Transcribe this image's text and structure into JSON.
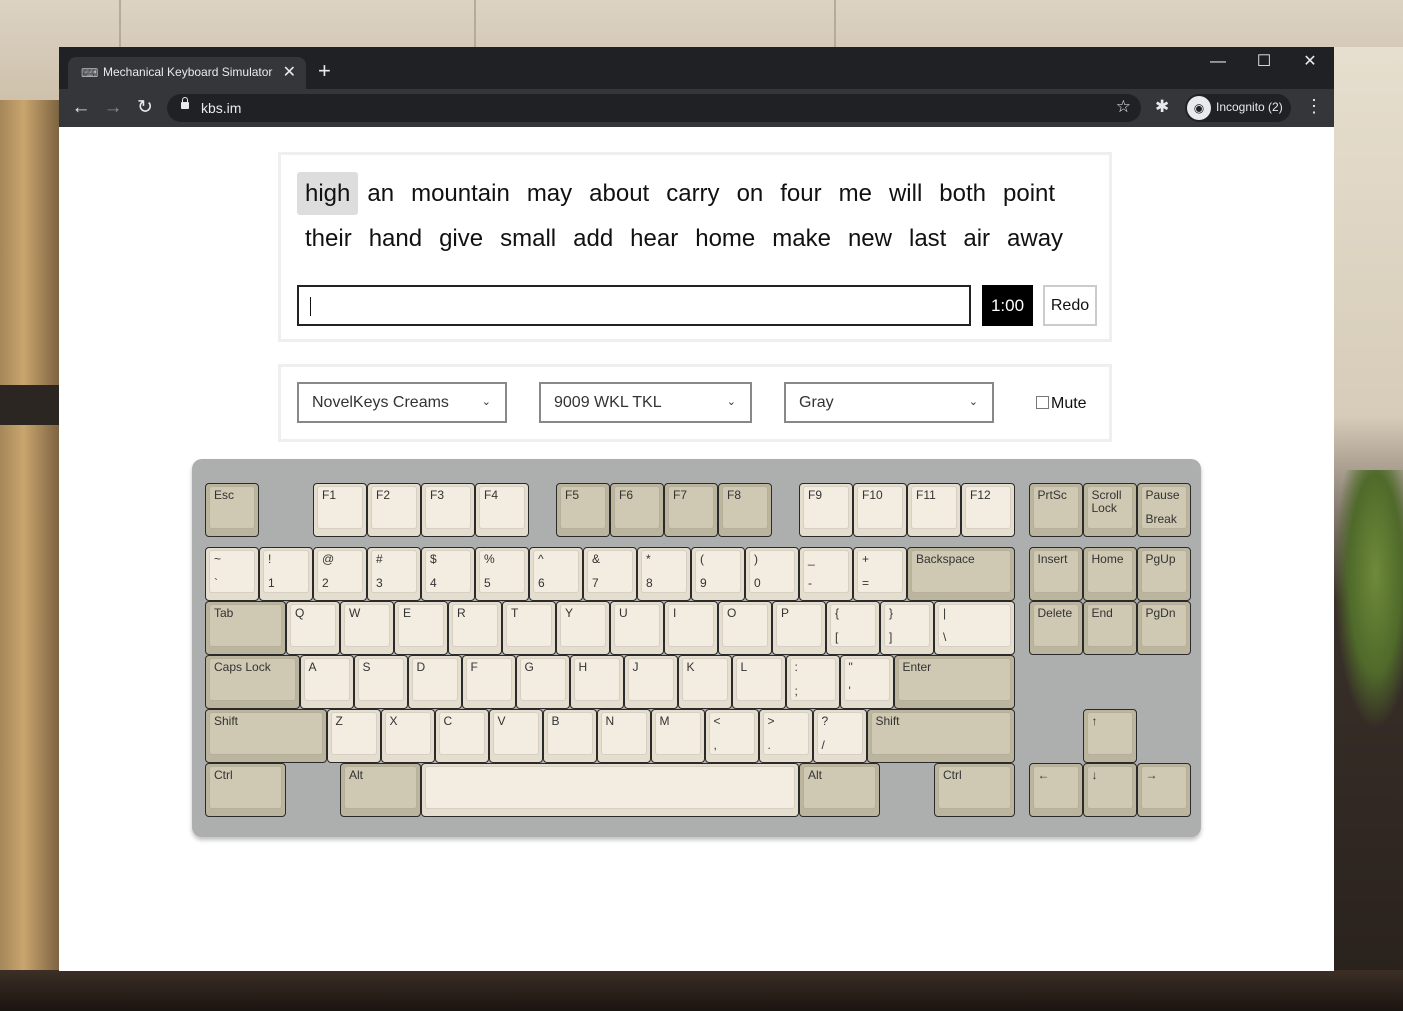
{
  "browser": {
    "tab_title": "Mechanical Keyboard Simulator",
    "tab_close": "✕",
    "new_tab": "+",
    "url": "kbs.im",
    "profile_label": "Incognito (2)",
    "back_icon": "←",
    "forward_icon": "→",
    "reload_icon": "↻",
    "star_icon": "☆",
    "extensions_icon": "✱",
    "menu_icon": "⋮",
    "minimize_icon": "—",
    "maximize_icon": "☐",
    "close_icon": "✕"
  },
  "typing": {
    "words": [
      "high",
      "an",
      "mountain",
      "may",
      "about",
      "carry",
      "on",
      "four",
      "me",
      "will",
      "both",
      "point",
      "their",
      "hand",
      "give",
      "small",
      "add",
      "hear",
      "home",
      "make",
      "new",
      "last",
      "air",
      "away"
    ],
    "active_word_index": 0,
    "input_value": "",
    "timer": "1:00",
    "redo_label": "Redo"
  },
  "options": {
    "switch_select": "NovelKeys Creams",
    "keyboard_select": "9009 WKL TKL",
    "color_select": "Gray",
    "mute_label": "Mute",
    "mute_checked": false,
    "chevron": "⌄"
  },
  "colors": {
    "alpha_key": "#f3ece0",
    "mod_key": "#cfc8b2",
    "case": "#adafae",
    "timer_bg": "#000000"
  },
  "keyboard": {
    "rows": [
      [
        {
          "t": "Esc",
          "x": 0,
          "w": 1,
          "m": 1
        },
        {
          "t": "F1",
          "x": 2,
          "w": 1
        },
        {
          "t": "F2",
          "x": 3,
          "w": 1
        },
        {
          "t": "F3",
          "x": 4,
          "w": 1
        },
        {
          "t": "F4",
          "x": 5,
          "w": 1
        },
        {
          "t": "F5",
          "x": 6.5,
          "w": 1,
          "m": 1
        },
        {
          "t": "F6",
          "x": 7.5,
          "w": 1,
          "m": 1
        },
        {
          "t": "F7",
          "x": 8.5,
          "w": 1,
          "m": 1
        },
        {
          "t": "F8",
          "x": 9.5,
          "w": 1,
          "m": 1
        },
        {
          "t": "F9",
          "x": 11,
          "w": 1
        },
        {
          "t": "F10",
          "x": 12,
          "w": 1
        },
        {
          "t": "F11",
          "x": 13,
          "w": 1
        },
        {
          "t": "F12",
          "x": 14,
          "w": 1
        },
        {
          "t": "PrtSc",
          "x": 15.25,
          "w": 1,
          "m": 1
        },
        {
          "t": "Scroll\nLock",
          "x": 16.25,
          "w": 1,
          "m": 1
        },
        {
          "t": "Pause",
          "b": "Break",
          "x": 17.25,
          "w": 1,
          "m": 1
        }
      ],
      [
        {
          "t": "~",
          "b": "`",
          "x": 0,
          "w": 1
        },
        {
          "t": "!",
          "b": "1",
          "x": 1,
          "w": 1
        },
        {
          "t": "@",
          "b": "2",
          "x": 2,
          "w": 1
        },
        {
          "t": "#",
          "b": "3",
          "x": 3,
          "w": 1
        },
        {
          "t": "$",
          "b": "4",
          "x": 4,
          "w": 1
        },
        {
          "t": "%",
          "b": "5",
          "x": 5,
          "w": 1
        },
        {
          "t": "^",
          "b": "6",
          "x": 6,
          "w": 1
        },
        {
          "t": "&",
          "b": "7",
          "x": 7,
          "w": 1
        },
        {
          "t": "*",
          "b": "8",
          "x": 8,
          "w": 1
        },
        {
          "t": "(",
          "b": "9",
          "x": 9,
          "w": 1
        },
        {
          "t": ")",
          "b": "0",
          "x": 10,
          "w": 1
        },
        {
          "t": "_",
          "b": "-",
          "x": 11,
          "w": 1
        },
        {
          "t": "+",
          "b": "=",
          "x": 12,
          "w": 1
        },
        {
          "t": "Backspace",
          "x": 13,
          "w": 2,
          "m": 1
        },
        {
          "t": "Insert",
          "x": 15.25,
          "w": 1,
          "m": 1
        },
        {
          "t": "Home",
          "x": 16.25,
          "w": 1,
          "m": 1
        },
        {
          "t": "PgUp",
          "x": 17.25,
          "w": 1,
          "m": 1
        }
      ],
      [
        {
          "t": "Tab",
          "x": 0,
          "w": 1.5,
          "m": 1
        },
        {
          "t": "Q",
          "x": 1.5,
          "w": 1
        },
        {
          "t": "W",
          "x": 2.5,
          "w": 1
        },
        {
          "t": "E",
          "x": 3.5,
          "w": 1
        },
        {
          "t": "R",
          "x": 4.5,
          "w": 1
        },
        {
          "t": "T",
          "x": 5.5,
          "w": 1
        },
        {
          "t": "Y",
          "x": 6.5,
          "w": 1
        },
        {
          "t": "U",
          "x": 7.5,
          "w": 1
        },
        {
          "t": "I",
          "x": 8.5,
          "w": 1
        },
        {
          "t": "O",
          "x": 9.5,
          "w": 1
        },
        {
          "t": "P",
          "x": 10.5,
          "w": 1
        },
        {
          "t": "{",
          "b": "[",
          "x": 11.5,
          "w": 1
        },
        {
          "t": "}",
          "b": "]",
          "x": 12.5,
          "w": 1
        },
        {
          "t": "|",
          "b": "\\",
          "x": 13.5,
          "w": 1.5
        },
        {
          "t": "Delete",
          "x": 15.25,
          "w": 1,
          "m": 1
        },
        {
          "t": "End",
          "x": 16.25,
          "w": 1,
          "m": 1
        },
        {
          "t": "PgDn",
          "x": 17.25,
          "w": 1,
          "m": 1
        }
      ],
      [
        {
          "t": "Caps Lock",
          "x": 0,
          "w": 1.75,
          "m": 1
        },
        {
          "t": "A",
          "x": 1.75,
          "w": 1
        },
        {
          "t": "S",
          "x": 2.75,
          "w": 1
        },
        {
          "t": "D",
          "x": 3.75,
          "w": 1
        },
        {
          "t": "F",
          "x": 4.75,
          "w": 1
        },
        {
          "t": "G",
          "x": 5.75,
          "w": 1
        },
        {
          "t": "H",
          "x": 6.75,
          "w": 1
        },
        {
          "t": "J",
          "x": 7.75,
          "w": 1
        },
        {
          "t": "K",
          "x": 8.75,
          "w": 1
        },
        {
          "t": "L",
          "x": 9.75,
          "w": 1
        },
        {
          "t": ":",
          "b": ";",
          "x": 10.75,
          "w": 1
        },
        {
          "t": "\"",
          "b": "'",
          "x": 11.75,
          "w": 1
        },
        {
          "t": "Enter",
          "x": 12.75,
          "w": 2.25,
          "m": 1
        }
      ],
      [
        {
          "t": "Shift",
          "x": 0,
          "w": 2.25,
          "m": 1
        },
        {
          "t": "Z",
          "x": 2.25,
          "w": 1
        },
        {
          "t": "X",
          "x": 3.25,
          "w": 1
        },
        {
          "t": "C",
          "x": 4.25,
          "w": 1
        },
        {
          "t": "V",
          "x": 5.25,
          "w": 1
        },
        {
          "t": "B",
          "x": 6.25,
          "w": 1
        },
        {
          "t": "N",
          "x": 7.25,
          "w": 1
        },
        {
          "t": "M",
          "x": 8.25,
          "w": 1
        },
        {
          "t": "<",
          "b": ",",
          "x": 9.25,
          "w": 1
        },
        {
          "t": ">",
          "b": ".",
          "x": 10.25,
          "w": 1
        },
        {
          "t": "?",
          "b": "/",
          "x": 11.25,
          "w": 1
        },
        {
          "t": "Shift",
          "x": 12.25,
          "w": 2.75,
          "m": 1
        },
        {
          "t": "↑",
          "x": 16.25,
          "w": 1,
          "m": 1
        }
      ],
      [
        {
          "t": "Ctrl",
          "x": 0,
          "w": 1.5,
          "m": 1
        },
        {
          "t": "Alt",
          "x": 2.5,
          "w": 1.5,
          "m": 1
        },
        {
          "t": "",
          "x": 4,
          "w": 7,
          "space": 1
        },
        {
          "t": "Alt",
          "x": 11,
          "w": 1.5,
          "m": 1
        },
        {
          "t": "Ctrl",
          "x": 13.5,
          "w": 1.5,
          "m": 1
        },
        {
          "t": "←",
          "x": 15.25,
          "w": 1,
          "m": 1
        },
        {
          "t": "↓",
          "x": 16.25,
          "w": 1,
          "m": 1
        },
        {
          "t": "→",
          "x": 17.25,
          "w": 1,
          "m": 1
        }
      ]
    ]
  }
}
